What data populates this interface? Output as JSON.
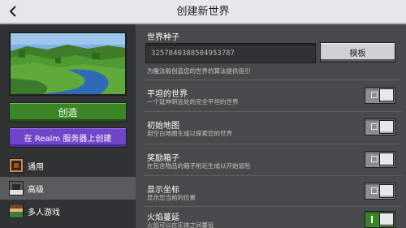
{
  "header": {
    "title": "创建新世界",
    "back_icon": "chevron-left-icon"
  },
  "left": {
    "create_label": "创造",
    "realm_label": "在 Realm 服务器上创建",
    "nav": [
      {
        "label": "通用",
        "icon": "general-icon",
        "active": false
      },
      {
        "label": "高级",
        "icon": "advanced-icon",
        "active": true
      },
      {
        "label": "多人游戏",
        "icon": "multiplayer-icon",
        "active": false
      }
    ]
  },
  "seed": {
    "label": "世界种子",
    "value": "3257840388504953787",
    "template_label": "模板",
    "hint": "为魔法般创造您的世界的算法提供指引"
  },
  "options": [
    {
      "label": "平坦的世界",
      "desc": "一个延伸到远处的完全平坦的世界",
      "on": false
    },
    {
      "label": "初始地图",
      "desc": "用空白地图生成以探索您的世界",
      "on": false
    },
    {
      "label": "奖励箱子",
      "desc": "在包含物品的箱子附近生成以开始冒险",
      "on": false
    },
    {
      "label": "显示坐标",
      "desc": "显示您当前的位置",
      "on": false
    },
    {
      "label": "火焰蔓延",
      "desc": "火焰可以在实体之间蔓延",
      "on": true
    }
  ],
  "colors": {
    "create_green": "#3c8527",
    "realm_purple": "#7045c9",
    "header_bg": "#e6e8eb"
  }
}
